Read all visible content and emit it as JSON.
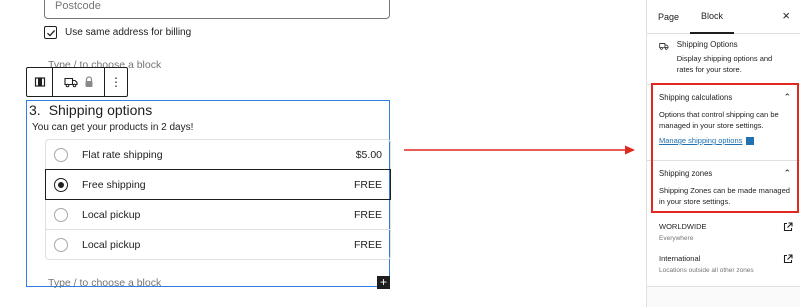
{
  "editor": {
    "postcode_placeholder": "Postcode",
    "same_address_label": "Use same address for billing",
    "type_block_placeholder": "Type / to choose a block",
    "block": {
      "number": "3.",
      "title": "Shipping options",
      "description": "You can get your products in 2 days!",
      "options": [
        {
          "label": "Flat rate shipping",
          "price": "$5.00",
          "selected": false
        },
        {
          "label": "Free shipping",
          "price": "FREE",
          "selected": true
        },
        {
          "label": "Local pickup",
          "price": "FREE",
          "selected": false
        },
        {
          "label": "Local pickup",
          "price": "FREE",
          "selected": false
        }
      ]
    },
    "toolbar": {
      "more": "⋮"
    },
    "plus": "+"
  },
  "sidebar": {
    "tabs": [
      "Page",
      "Block"
    ],
    "active_tab": "Block",
    "close": "×",
    "block_card": {
      "title": "Shipping Options",
      "description": "Display shipping options and rates for your store."
    },
    "calculations": {
      "title": "Shipping calculations",
      "body": "Options that control shipping can be managed in your store settings.",
      "link": "Manage shipping options"
    },
    "zones_panel": {
      "title": "Shipping zones",
      "body": "Shipping Zones can be made managed in your store settings."
    },
    "zones": [
      {
        "name": "WORLDWIDE",
        "desc": "Everywhere"
      },
      {
        "name": "International",
        "desc": "Locations outside all other zones"
      }
    ]
  },
  "colors": {
    "accent": "#2f7fe0",
    "highlight": "#e0281e",
    "link": "#2271b1"
  }
}
